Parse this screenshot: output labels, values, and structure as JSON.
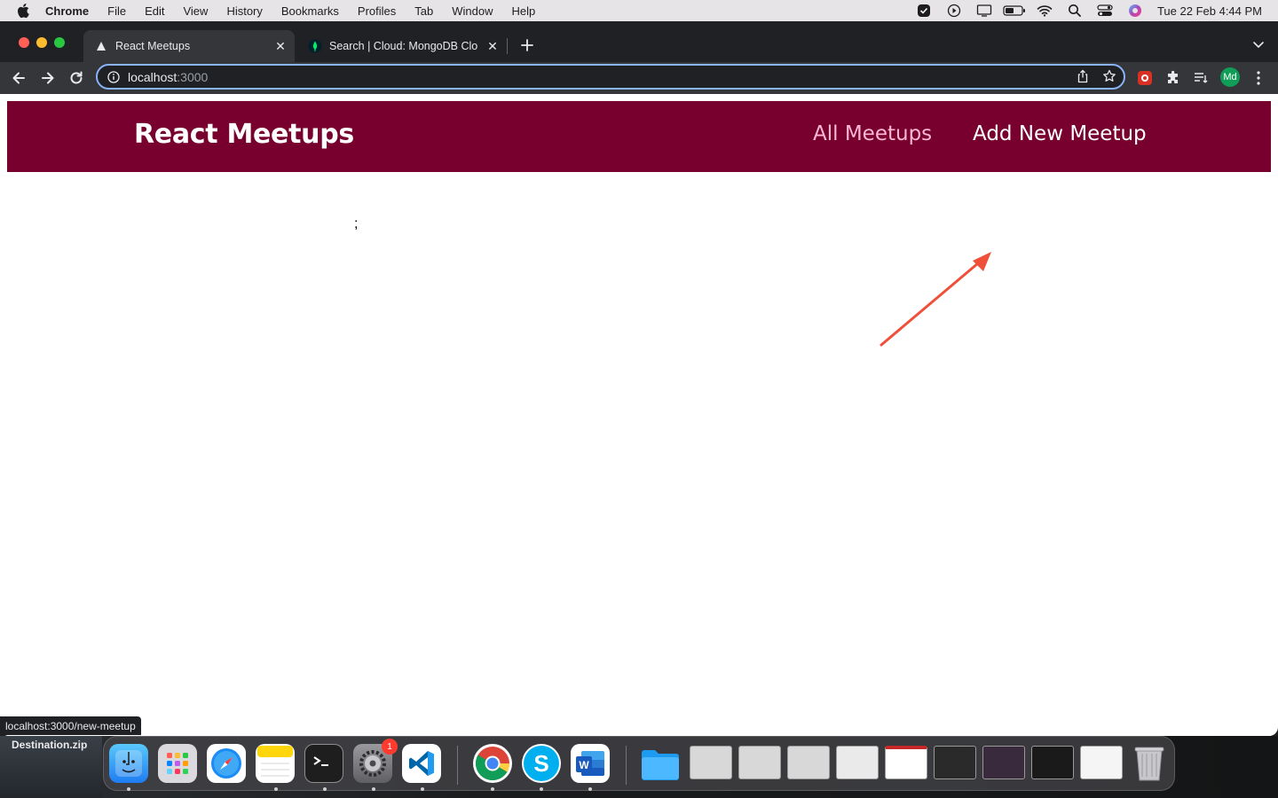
{
  "menubar": {
    "items": [
      "Chrome",
      "File",
      "Edit",
      "View",
      "History",
      "Bookmarks",
      "Profiles",
      "Tab",
      "Window",
      "Help"
    ],
    "clock": "Tue 22 Feb  4:44 PM"
  },
  "browser": {
    "tabs": [
      {
        "title": "React Meetups",
        "active": true
      },
      {
        "title": "Search | Cloud: MongoDB Clou",
        "active": false
      }
    ],
    "url_host": "localhost",
    "url_port": ":3000",
    "profile_initials": "Md",
    "status_url": "localhost:3000/new-meetup"
  },
  "page": {
    "logo": "React Meetups",
    "nav": {
      "all_meetups": "All Meetups",
      "add_new_meetup": "Add New Meetup"
    },
    "stray_text": ";"
  },
  "desktop": {
    "file_label": "Destination.zip",
    "settings_badge": "1"
  },
  "colors": {
    "header_bg": "#77002e",
    "nav_inactive": "#fcb8d2",
    "annotation_arrow": "#f0503a"
  }
}
